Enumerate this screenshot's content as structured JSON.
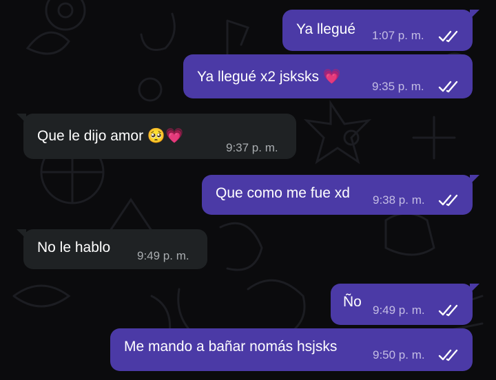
{
  "messages": [
    {
      "text": "Ya llegué",
      "time": "1:07 p. m.",
      "direction": "out",
      "status": "read"
    },
    {
      "text": "Ya llegué x2 jsksks",
      "emoji": "💗",
      "time": "9:35 p. m.",
      "direction": "out",
      "status": "read"
    },
    {
      "text": "Que le dijo amor",
      "emoji": "🥺💗",
      "time": "9:37 p. m.",
      "direction": "in"
    },
    {
      "text": "Que como me fue xd",
      "time": "9:38 p. m.",
      "direction": "out",
      "status": "read"
    },
    {
      "text": "No le hablo",
      "time": "9:49 p. m.",
      "direction": "in"
    },
    {
      "text": "Ño",
      "time": "9:49 p. m.",
      "direction": "out",
      "status": "read"
    },
    {
      "text": "Me mando a bañar nomás hsjsks",
      "time": "9:50 p. m.",
      "direction": "out",
      "status": "read"
    }
  ],
  "colors": {
    "background": "#0b0b0d",
    "outgoing_bubble": "#4b3aa6",
    "incoming_bubble": "#1f2224",
    "read_check": "#ffffff"
  },
  "icons": {
    "read_receipt": "double-check-icon"
  }
}
